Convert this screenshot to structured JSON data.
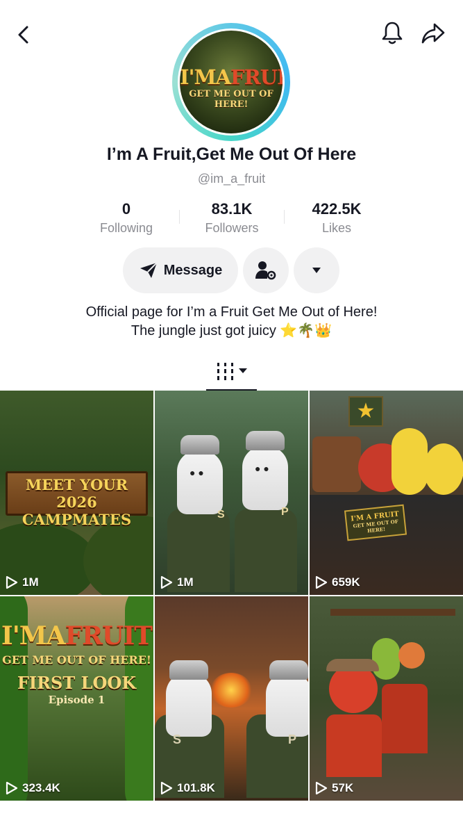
{
  "profile": {
    "name": "I’m A Fruit,Get Me Out Of Here",
    "handle": "@im_a_fruit",
    "avatar_line1_a": "I'MA",
    "avatar_line1_b": "FRUIT",
    "avatar_line2": "GET ME OUT OF HERE!",
    "ring_colors": [
      "#5ec8e6",
      "#46d6c8"
    ]
  },
  "stats": [
    {
      "value": "0",
      "label": "Following"
    },
    {
      "value": "83.1K",
      "label": "Followers"
    },
    {
      "value": "422.5K",
      "label": "Likes"
    }
  ],
  "actions": {
    "message_label": "Message"
  },
  "bio": {
    "line1": "Official page for I’m a Fruit Get Me Out of Here!",
    "line2": "The jungle just got juicy ⭐🌴👑"
  },
  "icons": {
    "back": "chevron-left-icon",
    "bell": "bell-icon",
    "share": "share-arrow-icon",
    "message": "send-icon",
    "add_friend": "person-settings-icon",
    "more": "caret-down-icon",
    "grid_tab": "grid-bars-icon"
  },
  "videos": [
    {
      "views": "1M",
      "overlay": [
        "MEET YOUR 2026",
        "CAMPMATES"
      ]
    },
    {
      "views": "1M",
      "overlay_s": "S",
      "overlay_p": "P"
    },
    {
      "views": "659K",
      "overlay": [
        "I'M A FRUIT",
        "GET ME OUT OF HERE!"
      ]
    },
    {
      "views": "323.4K",
      "overlay": [
        "I'MA",
        "FRUIT",
        "GET ME OUT OF HERE!",
        "FIRST LOOK",
        "Episode 1"
      ]
    },
    {
      "views": "101.8K",
      "overlay_s": "S",
      "overlay_p": "P"
    },
    {
      "views": "57K"
    }
  ]
}
